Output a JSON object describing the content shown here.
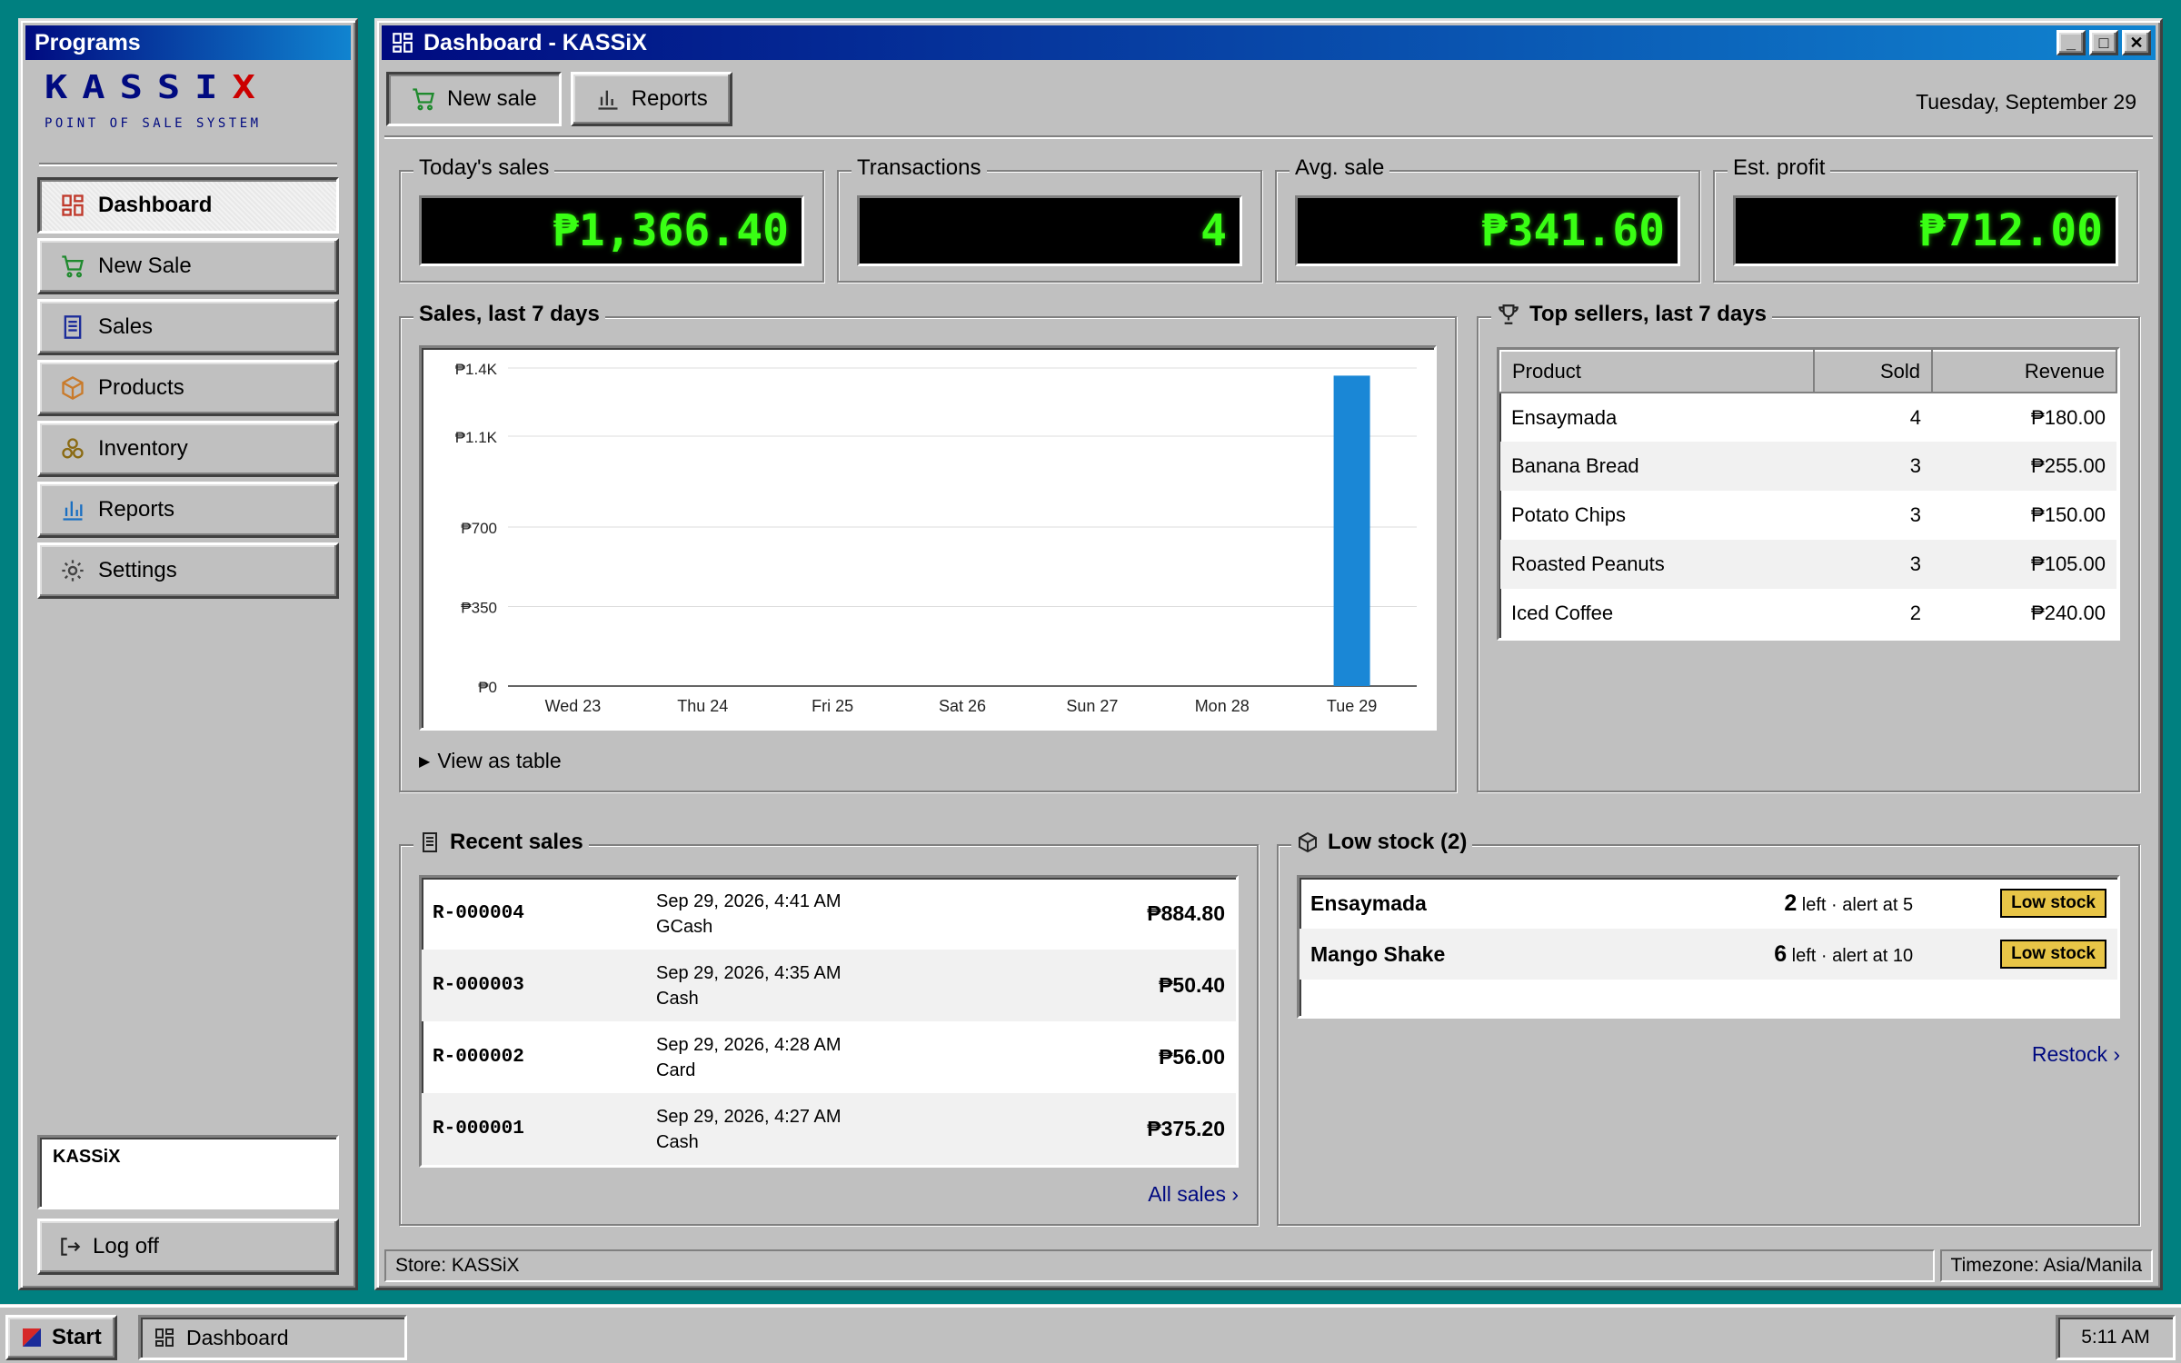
{
  "programs": {
    "title": "Programs",
    "logo_text": "KASSiX",
    "logo_main": "KASSI",
    "logo_x": "X",
    "logo_subtitle": "POINT OF SALE SYSTEM",
    "nav": [
      {
        "label": "Dashboard",
        "icon": "dashboard-icon",
        "active": true
      },
      {
        "label": "New Sale",
        "icon": "cart-icon"
      },
      {
        "label": "Sales",
        "icon": "receipt-icon"
      },
      {
        "label": "Products",
        "icon": "box-icon"
      },
      {
        "label": "Inventory",
        "icon": "inventory-icon"
      },
      {
        "label": "Reports",
        "icon": "bar-chart-icon"
      },
      {
        "label": "Settings",
        "icon": "gear-icon"
      }
    ],
    "user": "KASSiX",
    "logoff": "Log off"
  },
  "window": {
    "title": "Dashboard - KASSiX",
    "controls": [
      "_",
      "□",
      "✕"
    ]
  },
  "toolbar": {
    "new_sale": "New sale",
    "reports": "Reports",
    "date": "Tuesday, September 29"
  },
  "kpis": [
    {
      "label": "Today's sales",
      "value": "₱1,366.40"
    },
    {
      "label": "Transactions",
      "value": "4"
    },
    {
      "label": "Avg. sale",
      "value": "₱341.60"
    },
    {
      "label": "Est. profit",
      "value": "₱712.00"
    }
  ],
  "sales_chart": {
    "legend": "Sales, last 7 days",
    "toggle": "View as table"
  },
  "chart_data": {
    "type": "bar",
    "categories": [
      "Wed 23",
      "Thu 24",
      "Fri 25",
      "Sat 26",
      "Sun 27",
      "Mon 28",
      "Tue 29"
    ],
    "values": [
      0,
      0,
      0,
      0,
      0,
      0,
      1366.4
    ],
    "yticks": [
      0,
      350,
      700,
      1100,
      1400
    ],
    "ytick_labels": [
      "₱0",
      "₱350",
      "₱700",
      "₱1.1K",
      "₱1.4K"
    ],
    "ylim": [
      0,
      1400
    ],
    "grid": true,
    "bar_color": "#1a87d6"
  },
  "top_sellers": {
    "legend": "Top sellers, last 7 days",
    "columns": [
      "Product",
      "Sold",
      "Revenue"
    ],
    "rows": [
      [
        "Ensaymada",
        "4",
        "₱180.00"
      ],
      [
        "Banana Bread",
        "3",
        "₱255.00"
      ],
      [
        "Potato Chips",
        "3",
        "₱150.00"
      ],
      [
        "Roasted Peanuts",
        "3",
        "₱105.00"
      ],
      [
        "Iced Coffee",
        "2",
        "₱240.00"
      ]
    ]
  },
  "recent_sales": {
    "legend": "Recent sales",
    "rows": [
      {
        "id": "R-000004",
        "date": "Sep 29, 2026, 4:41 AM",
        "method": "GCash",
        "amount": "₱884.80"
      },
      {
        "id": "R-000003",
        "date": "Sep 29, 2026, 4:35 AM",
        "method": "Cash",
        "amount": "₱50.40"
      },
      {
        "id": "R-000002",
        "date": "Sep 29, 2026, 4:28 AM",
        "method": "Card",
        "amount": "₱56.00"
      },
      {
        "id": "R-000001",
        "date": "Sep 29, 2026, 4:27 AM",
        "method": "Cash",
        "amount": "₱375.20"
      }
    ],
    "link": "All sales ›"
  },
  "low_stock": {
    "legend": "Low stock (2)",
    "rows": [
      {
        "name": "Ensaymada",
        "qty": "2",
        "detail": " left · alert at 5",
        "badge": "Low stock"
      },
      {
        "name": "Mango Shake",
        "qty": "6",
        "detail": " left · alert at 10",
        "badge": "Low stock"
      }
    ],
    "link": "Restock ›"
  },
  "statusbar": {
    "store": "Store: KASSiX",
    "timezone": "Timezone: Asia/Manila"
  },
  "taskbar": {
    "start": "Start",
    "task": "Dashboard",
    "clock": "5:11 AM"
  }
}
